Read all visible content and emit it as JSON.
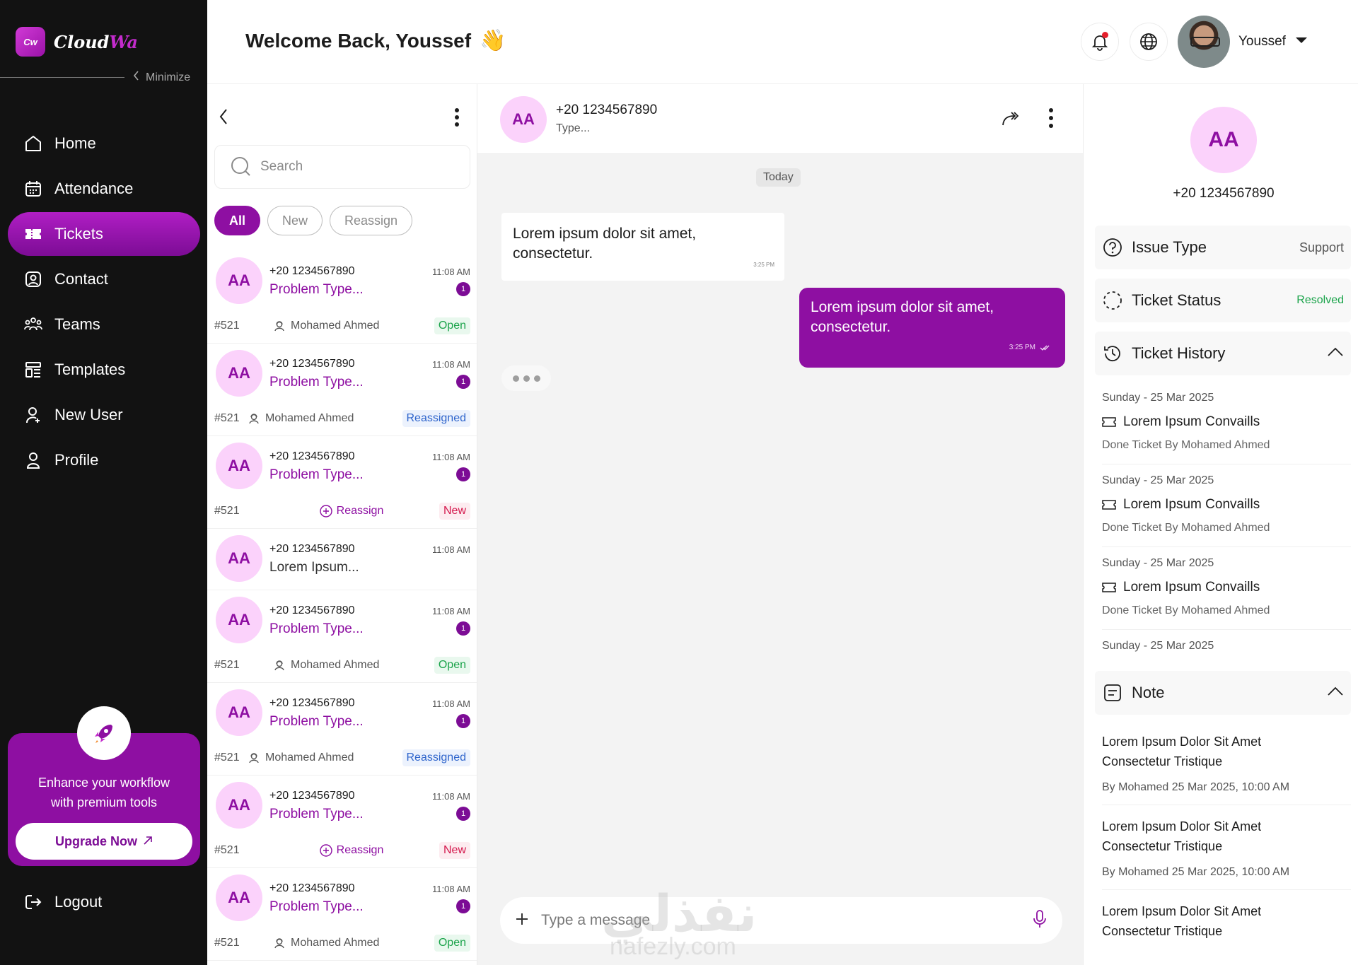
{
  "brand": {
    "logo_badge": "Cw",
    "name_main": "Cloud",
    "name_accent": "Wa"
  },
  "sidebar": {
    "minimize_label": "Minimize",
    "items": [
      {
        "label": "Home",
        "icon": "home-icon",
        "active": false
      },
      {
        "label": "Attendance",
        "icon": "calendar-icon",
        "active": false
      },
      {
        "label": "Tickets",
        "icon": "ticket-icon",
        "active": true
      },
      {
        "label": "Contact",
        "icon": "contact-icon",
        "active": false
      },
      {
        "label": "Teams",
        "icon": "teams-icon",
        "active": false
      },
      {
        "label": "Templates",
        "icon": "templates-icon",
        "active": false
      },
      {
        "label": "New User",
        "icon": "add-user-icon",
        "active": false
      },
      {
        "label": "Profile",
        "icon": "profile-icon",
        "active": false
      }
    ],
    "promo": {
      "text_line1": "Enhance your workflow",
      "text_line2": "with premium tools",
      "button_label": "Upgrade Now"
    },
    "logout_label": "Logout"
  },
  "header": {
    "welcome": "Welcome Back, Youssef",
    "user_name": "Youssef"
  },
  "list": {
    "search_placeholder": "Search",
    "filters": [
      "All",
      "New",
      "Reassign"
    ],
    "chats": [
      {
        "initials": "AA",
        "phone": "+20 1234567890",
        "title": "Problem Type...",
        "time": "11:08 AM",
        "unread": "1",
        "ticket": "#521",
        "agent": "Mohamed Ahmed",
        "status": "Open"
      },
      {
        "initials": "AA",
        "phone": "+20 1234567890",
        "title": "Problem Type...",
        "time": "11:08 AM",
        "unread": "1",
        "ticket": "#521",
        "agent": "Mohamed Ahmed",
        "status": "Reassigned"
      },
      {
        "initials": "AA",
        "phone": "+20 1234567890",
        "title": "Problem Type...",
        "time": "11:08 AM",
        "unread": "1",
        "ticket": "#521",
        "reassign": "Reassign",
        "status": "New"
      },
      {
        "initials": "AA",
        "phone": "+20 1234567890",
        "title": "Lorem Ipsum...",
        "time": "11:08 AM"
      },
      {
        "initials": "AA",
        "phone": "+20 1234567890",
        "title": "Problem Type...",
        "time": "11:08 AM",
        "unread": "1",
        "ticket": "#521",
        "agent": "Mohamed Ahmed",
        "status": "Open"
      },
      {
        "initials": "AA",
        "phone": "+20 1234567890",
        "title": "Problem Type...",
        "time": "11:08 AM",
        "unread": "1",
        "ticket": "#521",
        "agent": "Mohamed Ahmed",
        "status": "Reassigned"
      },
      {
        "initials": "AA",
        "phone": "+20 1234567890",
        "title": "Problem Type...",
        "time": "11:08 AM",
        "unread": "1",
        "ticket": "#521",
        "reassign": "Reassign",
        "status": "New"
      },
      {
        "initials": "AA",
        "phone": "+20 1234567890",
        "title": "Problem Type...",
        "time": "11:08 AM",
        "unread": "1",
        "ticket": "#521",
        "agent": "Mohamed Ahmed",
        "status": "Open"
      }
    ]
  },
  "chat": {
    "initials": "AA",
    "phone": "+20 1234567890",
    "status": "Type...",
    "day_label": "Today",
    "incoming": {
      "text": "Lorem ipsum dolor sit amet, consectetur.",
      "time": "3:25 PM"
    },
    "outgoing": {
      "text": "Lorem ipsum dolor sit amet, consectetur.",
      "time": "3:25 PM"
    },
    "composer_placeholder": "Type a message"
  },
  "info": {
    "initials": "AA",
    "phone": "+20 1234567890",
    "issue_type_label": "Issue Type",
    "issue_type_value": "Support",
    "ticket_status_label": "Ticket Status",
    "ticket_status_value": "Resolved",
    "history_label": "Ticket History",
    "history": [
      {
        "date": "Sunday - 25 Mar 2025",
        "title": "Lorem Ipsum Convaills",
        "sub": "Done Ticket By Mohamed Ahmed"
      },
      {
        "date": "Sunday - 25 Mar 2025",
        "title": "Lorem Ipsum Convaills",
        "sub": "Done Ticket By Mohamed Ahmed"
      },
      {
        "date": "Sunday - 25 Mar 2025",
        "title": "Lorem Ipsum Convaills",
        "sub": "Done Ticket By Mohamed Ahmed"
      },
      {
        "date": "Sunday - 25 Mar 2025"
      }
    ],
    "note_label": "Note",
    "notes": [
      {
        "text": "Lorem Ipsum Dolor Sit Amet Consectetur Tristique",
        "by": "By Mohamed 25 Mar 2025, 10:00 AM"
      },
      {
        "text": "Lorem Ipsum Dolor Sit Amet Consectetur Tristique",
        "by": "By Mohamed 25 Mar 2025, 10:00 AM"
      },
      {
        "text": "Lorem Ipsum Dolor Sit Amet Consectetur Tristique"
      }
    ]
  },
  "watermark": {
    "main": "نفذلي",
    "sub": "nafezly.com"
  },
  "colors": {
    "accent": "#8e0fa2",
    "avatar_bg": "#fbd2fb",
    "sidebar_bg": "#121212",
    "open": "#1aa34a",
    "reassigned": "#2f65cc",
    "new": "#d4174c"
  }
}
